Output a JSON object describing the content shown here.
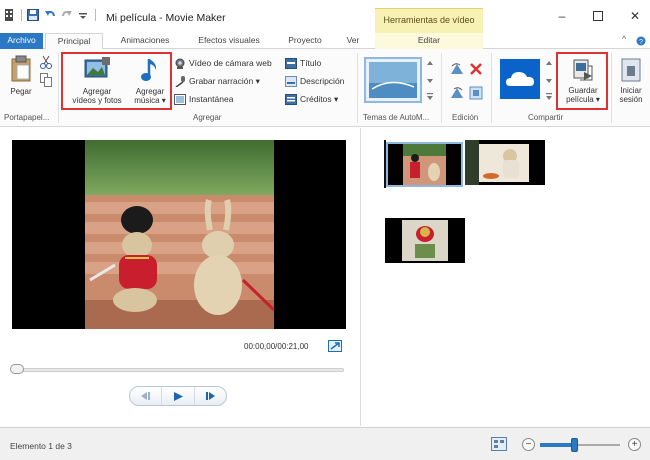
{
  "window": {
    "title": "Mi película - Movie Maker",
    "contextual_group": "Herramientas de vídeo"
  },
  "tabs": [
    "Archivo",
    "Principal",
    "Animaciones",
    "Efectos visuales",
    "Proyecto",
    "Ver",
    "Editar"
  ],
  "ribbon": {
    "pegar": "Pegar",
    "agregar_videos": [
      "Agregar",
      "vídeos y fotos"
    ],
    "agregar_musica": [
      "Agregar",
      "música ▾"
    ],
    "video_camara": "Vídeo de cámara web",
    "grabar_narracion": "Grabar narración ▾",
    "instantanea": "Instantánea",
    "titulo": "Título",
    "descripcion": "Descripción",
    "creditos": "Créditos ▾",
    "guardar_pelicula": [
      "Guardar",
      "película ▾"
    ],
    "iniciar_sesion": [
      "Iniciar",
      "sesión"
    ],
    "groups": {
      "portapapeles": "Portapapel...",
      "agregar": "Agregar",
      "temas": "Temas de AutoM...",
      "edicion": "Edición",
      "compartir": "Compartir"
    }
  },
  "player": {
    "time": "00:00,00/00:21,00"
  },
  "status": {
    "text": "Elemento 1 de 3",
    "zoom_level": 0.42
  },
  "colors": {
    "accent": "#2b78c5",
    "highlight_box": "#dd3333",
    "contextual_tab": "#f7f1b3"
  }
}
